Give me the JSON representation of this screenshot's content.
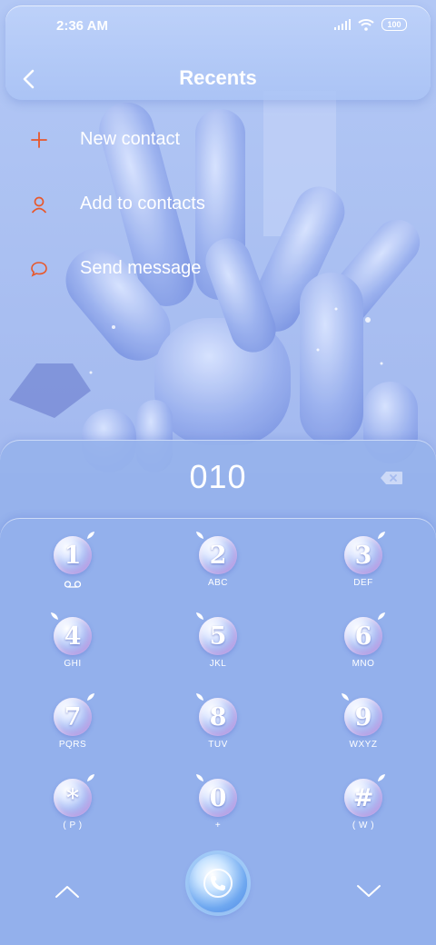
{
  "status": {
    "time": "2:36 AM",
    "battery": "100"
  },
  "header": {
    "title": "Recents"
  },
  "actions": [
    {
      "label": "New contact",
      "icon": "plus-icon"
    },
    {
      "label": "Add to contacts",
      "icon": "person-icon"
    },
    {
      "label": "Send message",
      "icon": "message-icon"
    }
  ],
  "dialer": {
    "number": "010",
    "keys": [
      {
        "digit": "1",
        "sub": "voicemail-icon"
      },
      {
        "digit": "2",
        "sub": "ABC"
      },
      {
        "digit": "3",
        "sub": "DEF"
      },
      {
        "digit": "4",
        "sub": "GHI"
      },
      {
        "digit": "5",
        "sub": "JKL"
      },
      {
        "digit": "6",
        "sub": "MNO"
      },
      {
        "digit": "7",
        "sub": "PQRS"
      },
      {
        "digit": "8",
        "sub": "TUV"
      },
      {
        "digit": "9",
        "sub": "WXYZ"
      },
      {
        "digit": "*",
        "sub": "( P )"
      },
      {
        "digit": "0",
        "sub": "+"
      },
      {
        "digit": "#",
        "sub": "( W )"
      }
    ]
  },
  "colors": {
    "accent": "#e8582b",
    "text": "#ffffff"
  }
}
